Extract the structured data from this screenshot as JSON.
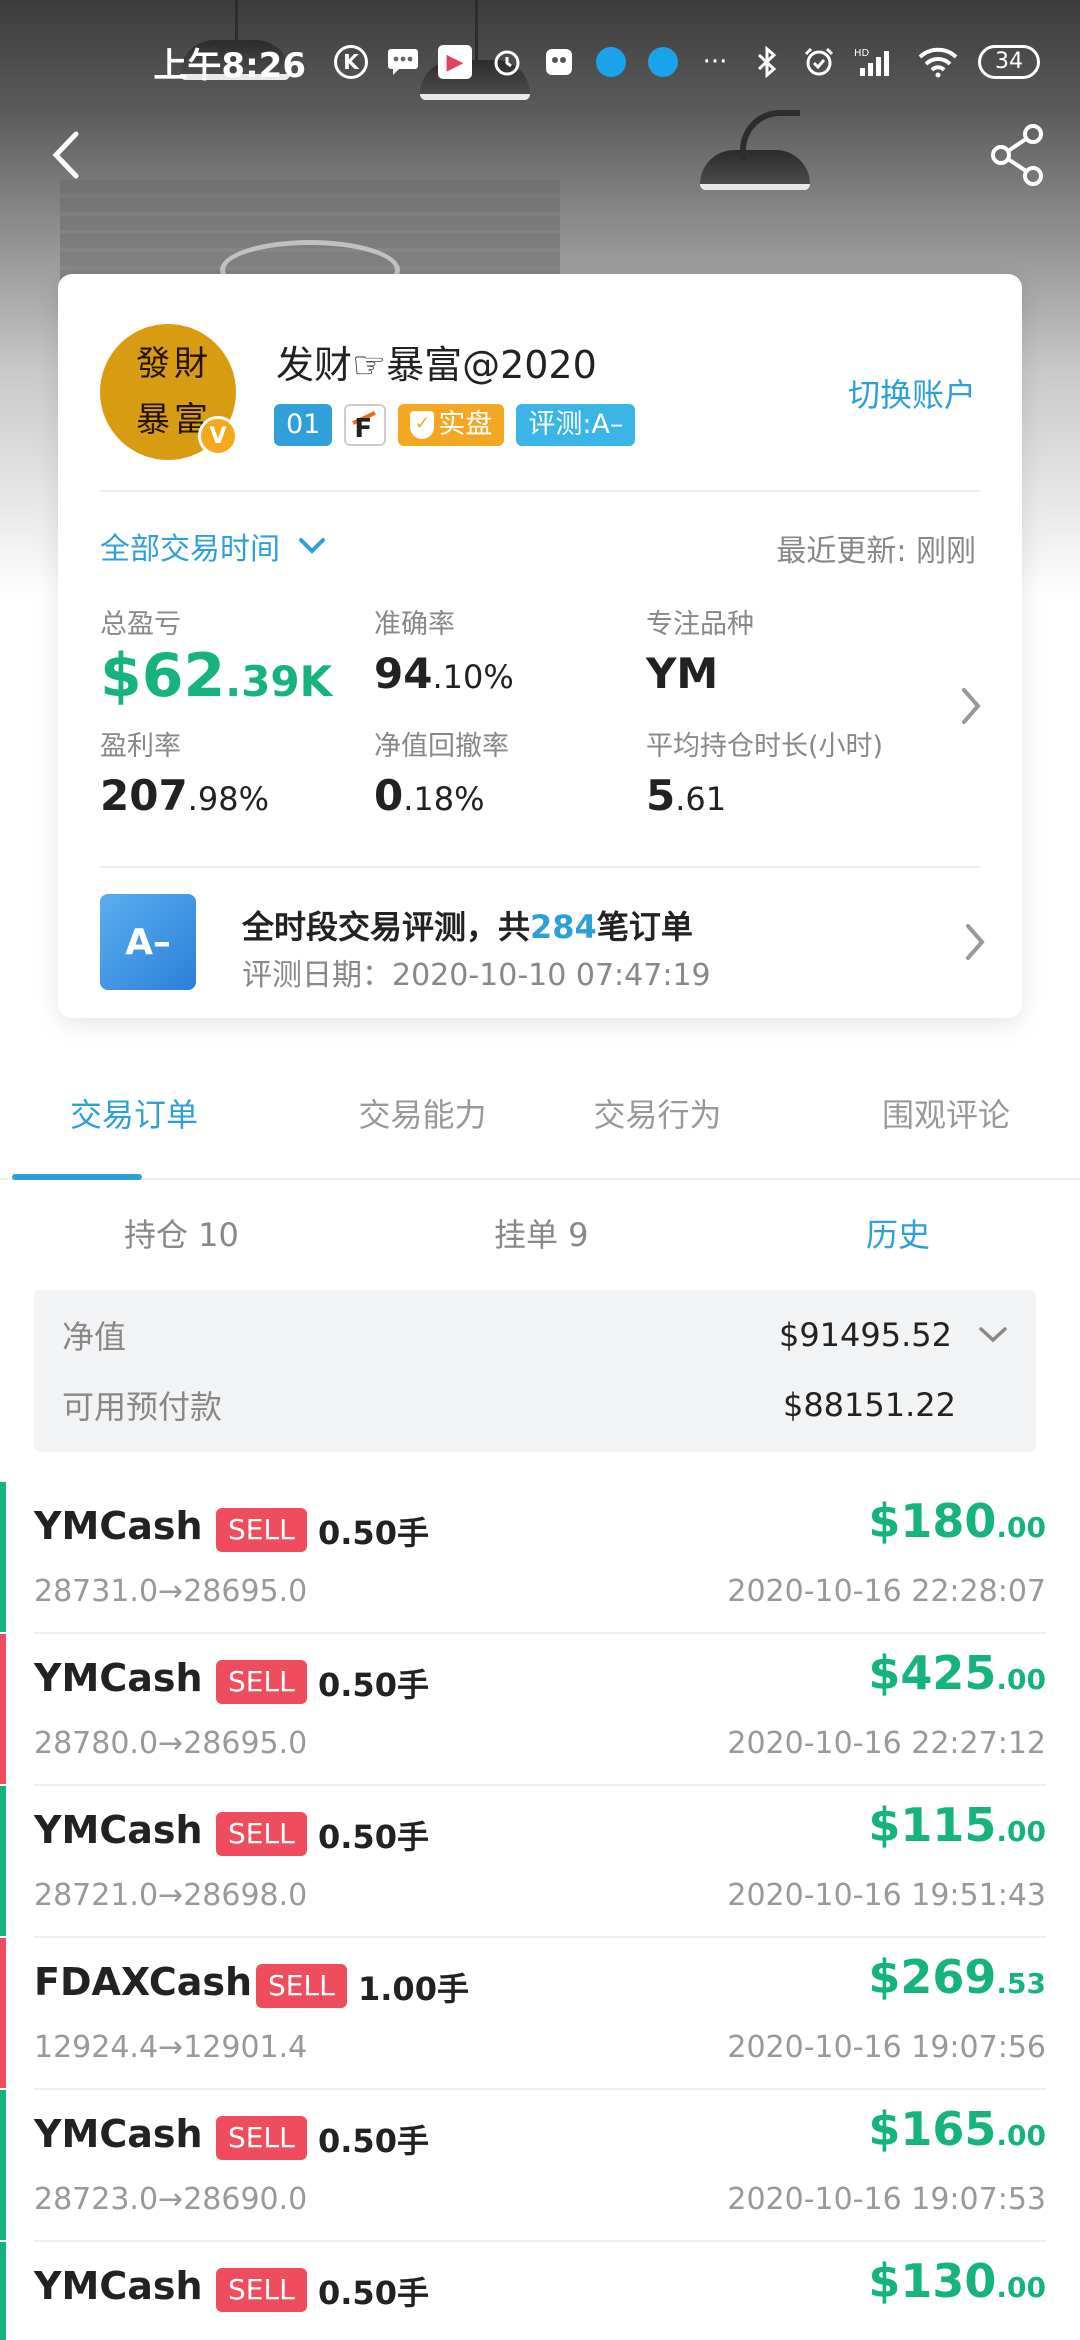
{
  "status_bar": {
    "time": "上午8:26",
    "battery": "34",
    "icons": [
      "k-circle-icon",
      "message-icon",
      "play-store-icon",
      "alarm-icon",
      "app-icon",
      "blue-dot-icon",
      "blue-dot-icon",
      "more-icon",
      "bluetooth-icon",
      "alarm-clock-icon",
      "signal-icon",
      "wifi-icon",
      "battery-icon"
    ],
    "hd": "HD"
  },
  "nav": {
    "back_icon": "chevron-left-icon",
    "share_icon": "share-icon"
  },
  "profile": {
    "avatar_text_1": "發財",
    "avatar_text_2": "暴富",
    "verified_mark": "V",
    "username": "发财☞暴富@2020",
    "tag_number": "01",
    "tag_logo": "F",
    "tag_real": "实盘",
    "tag_rating": "评测:A–",
    "switch_account": "切换账户"
  },
  "period": {
    "label": "全部交易时间",
    "updated": "最近更新: 刚刚"
  },
  "stats": {
    "total_pnl_label": "总盈亏",
    "total_pnl_main": "$62",
    "total_pnl_sub": ".39K",
    "accuracy_label": "准确率",
    "accuracy_main": "94",
    "accuracy_sub": ".10%",
    "focus_label": "专注品种",
    "focus_value": "YM",
    "profit_rate_label": "盈利率",
    "profit_rate_main": "207",
    "profit_rate_sub": ".98%",
    "drawdown_label": "净值回撤率",
    "drawdown_main": "0",
    "drawdown_sub": ".18%",
    "hold_label": "平均持仓时长(小时)",
    "hold_main": "5",
    "hold_sub": ".61"
  },
  "evaluation": {
    "grade": "A–",
    "title_pre": "全时段交易评测，共",
    "title_count": "284",
    "title_post": "笔订单",
    "date": "评测日期：2020-10-10 07:47:19"
  },
  "main_tabs": [
    "交易订单",
    "交易能力",
    "交易行为",
    "围观评论"
  ],
  "sub_tabs": [
    "持仓 10",
    "挂单 9",
    "历史"
  ],
  "equity": {
    "net_label": "净值",
    "net_value": "$91495.52",
    "available_label": "可用预付款",
    "available_value": "$88151.22"
  },
  "colors": {
    "accent": "#2ea0d8",
    "profit": "#16b37e",
    "sell": "#ef4d5d",
    "bar_green": "#16b37e",
    "bar_red": "#ef4d5d"
  },
  "orders": [
    {
      "symbol": "YMCash",
      "side": "SELL",
      "lots": "0.50手",
      "prices": "28731.0→28695.0",
      "pnl_main": "$180",
      "pnl_cents": ".00",
      "time": "2020-10-16 22:28:07",
      "bar": "green"
    },
    {
      "symbol": "YMCash",
      "side": "SELL",
      "lots": "0.50手",
      "prices": "28780.0→28695.0",
      "pnl_main": "$425",
      "pnl_cents": ".00",
      "time": "2020-10-16 22:27:12",
      "bar": "red"
    },
    {
      "symbol": "YMCash",
      "side": "SELL",
      "lots": "0.50手",
      "prices": "28721.0→28698.0",
      "pnl_main": "$115",
      "pnl_cents": ".00",
      "time": "2020-10-16 19:51:43",
      "bar": "green"
    },
    {
      "symbol": "FDAXCash",
      "side": "SELL",
      "lots": "1.00手",
      "prices": "12924.4→12901.4",
      "pnl_main": "$269",
      "pnl_cents": ".53",
      "time": "2020-10-16 19:07:56",
      "bar": "red"
    },
    {
      "symbol": "YMCash",
      "side": "SELL",
      "lots": "0.50手",
      "prices": "28723.0→28690.0",
      "pnl_main": "$165",
      "pnl_cents": ".00",
      "time": "2020-10-16 19:07:53",
      "bar": "green"
    },
    {
      "symbol": "YMCash",
      "side": "SELL",
      "lots": "0.50手",
      "prices": "",
      "pnl_main": "$130",
      "pnl_cents": ".00",
      "time": "",
      "bar": "green"
    }
  ]
}
